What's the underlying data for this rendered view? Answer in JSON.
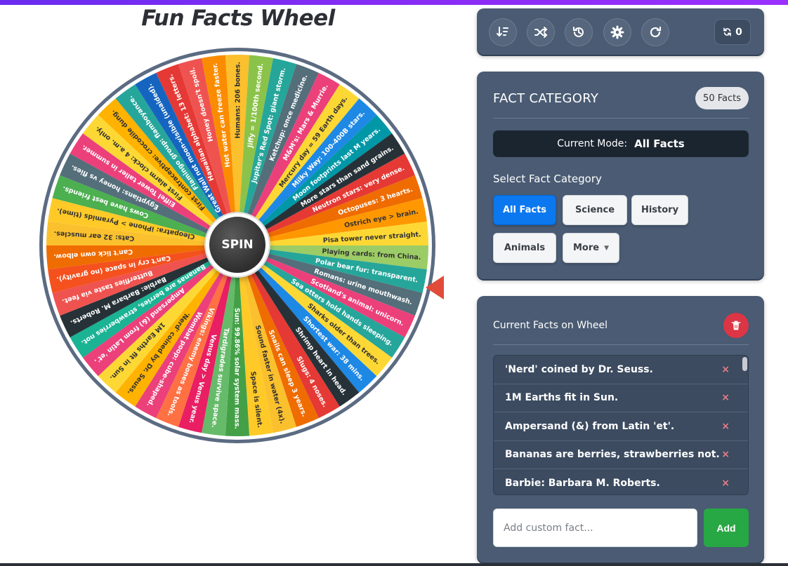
{
  "title": "Fun Facts Wheel",
  "wheel": {
    "spin_label": "SPIN",
    "segments": [
      {
        "text": "Playing cards: from China.",
        "color": "#9ccc65"
      },
      {
        "text": "Polar bear fur: transparent.",
        "color": "#26a69a"
      },
      {
        "text": "Romans: urine mouthwash.",
        "color": "#546e7a"
      },
      {
        "text": "Scotland's animal: unicorn.",
        "color": "#ec407a"
      },
      {
        "text": "Sea otters hold hands sleeping.",
        "color": "#26a69a"
      },
      {
        "text": "Sharks older than trees.",
        "color": "#fdd835"
      },
      {
        "text": "Shortest war: 38 mins.",
        "color": "#1e88e5"
      },
      {
        "text": "Shrimp heart in head.",
        "color": "#263238"
      },
      {
        "text": "Slugs: 4 noses.",
        "color": "#e53935"
      },
      {
        "text": "Snails can sleep 3 years.",
        "color": "#ef6c00"
      },
      {
        "text": "Sound faster in water (4x).",
        "color": "#fbc02d"
      },
      {
        "text": "Space is silent.",
        "color": "#ffca28"
      },
      {
        "text": "Sun: 99.86% solar system mass.",
        "color": "#43a047"
      },
      {
        "text": "Tardigrades survive space.",
        "color": "#66bb6a"
      },
      {
        "text": "Venus day > Venus year.",
        "color": "#e91e63"
      },
      {
        "text": "Vikings: enemy bones as tools.",
        "color": "#ff7043"
      },
      {
        "text": "Wombat poop: cube-shaped.",
        "color": "#ec407a"
      },
      {
        "text": "'Nerd' coined by Dr. Seuss.",
        "color": "#ffb300"
      },
      {
        "text": "1M Earths fit in Sun.",
        "color": "#fdd835"
      },
      {
        "text": "Ampersand (&) from Latin 'et'.",
        "color": "#ec407a"
      },
      {
        "text": "Bananas are berries, strawberries not.",
        "color": "#1ab394"
      },
      {
        "text": "Barbie: Barbara M. Roberts.",
        "color": "#263238"
      },
      {
        "text": "Butterflies taste via feet.",
        "color": "#ef5350"
      },
      {
        "text": "Can't cry in space (no gravity).",
        "color": "#f4511e"
      },
      {
        "text": "Can't lick own elbow.",
        "color": "#ef6c00"
      },
      {
        "text": "Cats: 32 ear muscles.",
        "color": "#fbc02d"
      },
      {
        "text": "Cleopatra: iPhone > Pyramids (time).",
        "color": "#ffca28"
      },
      {
        "text": "Cows have best friends.",
        "color": "#4caf50"
      },
      {
        "text": "Egyptians: honey vs flies.",
        "color": "#546e7a"
      },
      {
        "text": "Eiffel Tower taller in summer.",
        "color": "#ec407a"
      },
      {
        "text": "First alarm clock: 4 a.m. only.",
        "color": "#fdd835"
      },
      {
        "text": "First contraceptive: crocodile dung.",
        "color": "#ffb300"
      },
      {
        "text": "Flamingo group: flamboyance.",
        "color": "#26a69a"
      },
      {
        "text": "Great Wall not moon-visible (unaided).",
        "color": "#1565c0"
      },
      {
        "text": "Hawaiian alphabet: 13 letters.",
        "color": "#e53935"
      },
      {
        "text": "Honey doesn't spoil.",
        "color": "#ef5350"
      },
      {
        "text": "Hot water can freeze faster.",
        "color": "#fb8c00"
      },
      {
        "text": "Humans: 206 bones.",
        "color": "#fbc02d"
      },
      {
        "text": "Jiffy = 1/100th second.",
        "color": "#8bc34a"
      },
      {
        "text": "Jupiter's Red Spot: giant storm.",
        "color": "#26a69a"
      },
      {
        "text": "Ketchup: once medicine.",
        "color": "#546e7a"
      },
      {
        "text": "M&M's: Mars & Murrie.",
        "color": "#ec407a"
      },
      {
        "text": "Mercury day = 59 Earth days.",
        "color": "#fdd835"
      },
      {
        "text": "Milky Way: 100-400B stars.",
        "color": "#1e88e5"
      },
      {
        "text": "Moon footprints last M years.",
        "color": "#0097a7"
      },
      {
        "text": "More stars than sand grains.",
        "color": "#263238"
      },
      {
        "text": "Neutron stars: very dense.",
        "color": "#e53935"
      },
      {
        "text": "Octopuses: 3 hearts.",
        "color": "#ef6c00"
      },
      {
        "text": "Ostrich eye > brain.",
        "color": "#ff9800"
      },
      {
        "text": "Pisa tower never straight.",
        "color": "#fdd835"
      }
    ]
  },
  "toolbar": {
    "buttons": [
      {
        "name": "sort-button",
        "icon": "sort-icon"
      },
      {
        "name": "shuffle-button",
        "icon": "shuffle-icon"
      },
      {
        "name": "history-button",
        "icon": "history-icon"
      },
      {
        "name": "settings-button",
        "icon": "gear-icon"
      },
      {
        "name": "reset-button",
        "icon": "refresh-icon"
      }
    ],
    "spin_count": "0"
  },
  "category": {
    "heading": "FACT CATEGORY",
    "facts_badge": "50 Facts",
    "mode_label": "Current Mode:",
    "mode_value": "All Facts",
    "select_label": "Select Fact Category",
    "buttons": [
      "All Facts",
      "Science",
      "History",
      "Animals",
      "More"
    ],
    "active": "All Facts"
  },
  "facts": {
    "heading": "Current Facts on Wheel",
    "items": [
      "'Nerd' coined by Dr. Seuss.",
      "1M Earths fit in Sun.",
      "Ampersand (&) from Latin 'et'.",
      "Bananas are berries, strawberries not.",
      "Barbie: Barbara M. Roberts."
    ],
    "remove_symbol": "×",
    "input_placeholder": "Add custom fact...",
    "add_label": "Add"
  },
  "colors": {
    "panel": "#4a5b73",
    "active_button": "#0b78f0",
    "add_button": "#28a745",
    "delete_button": "#dc3545",
    "pointer": "#e04b3a"
  }
}
